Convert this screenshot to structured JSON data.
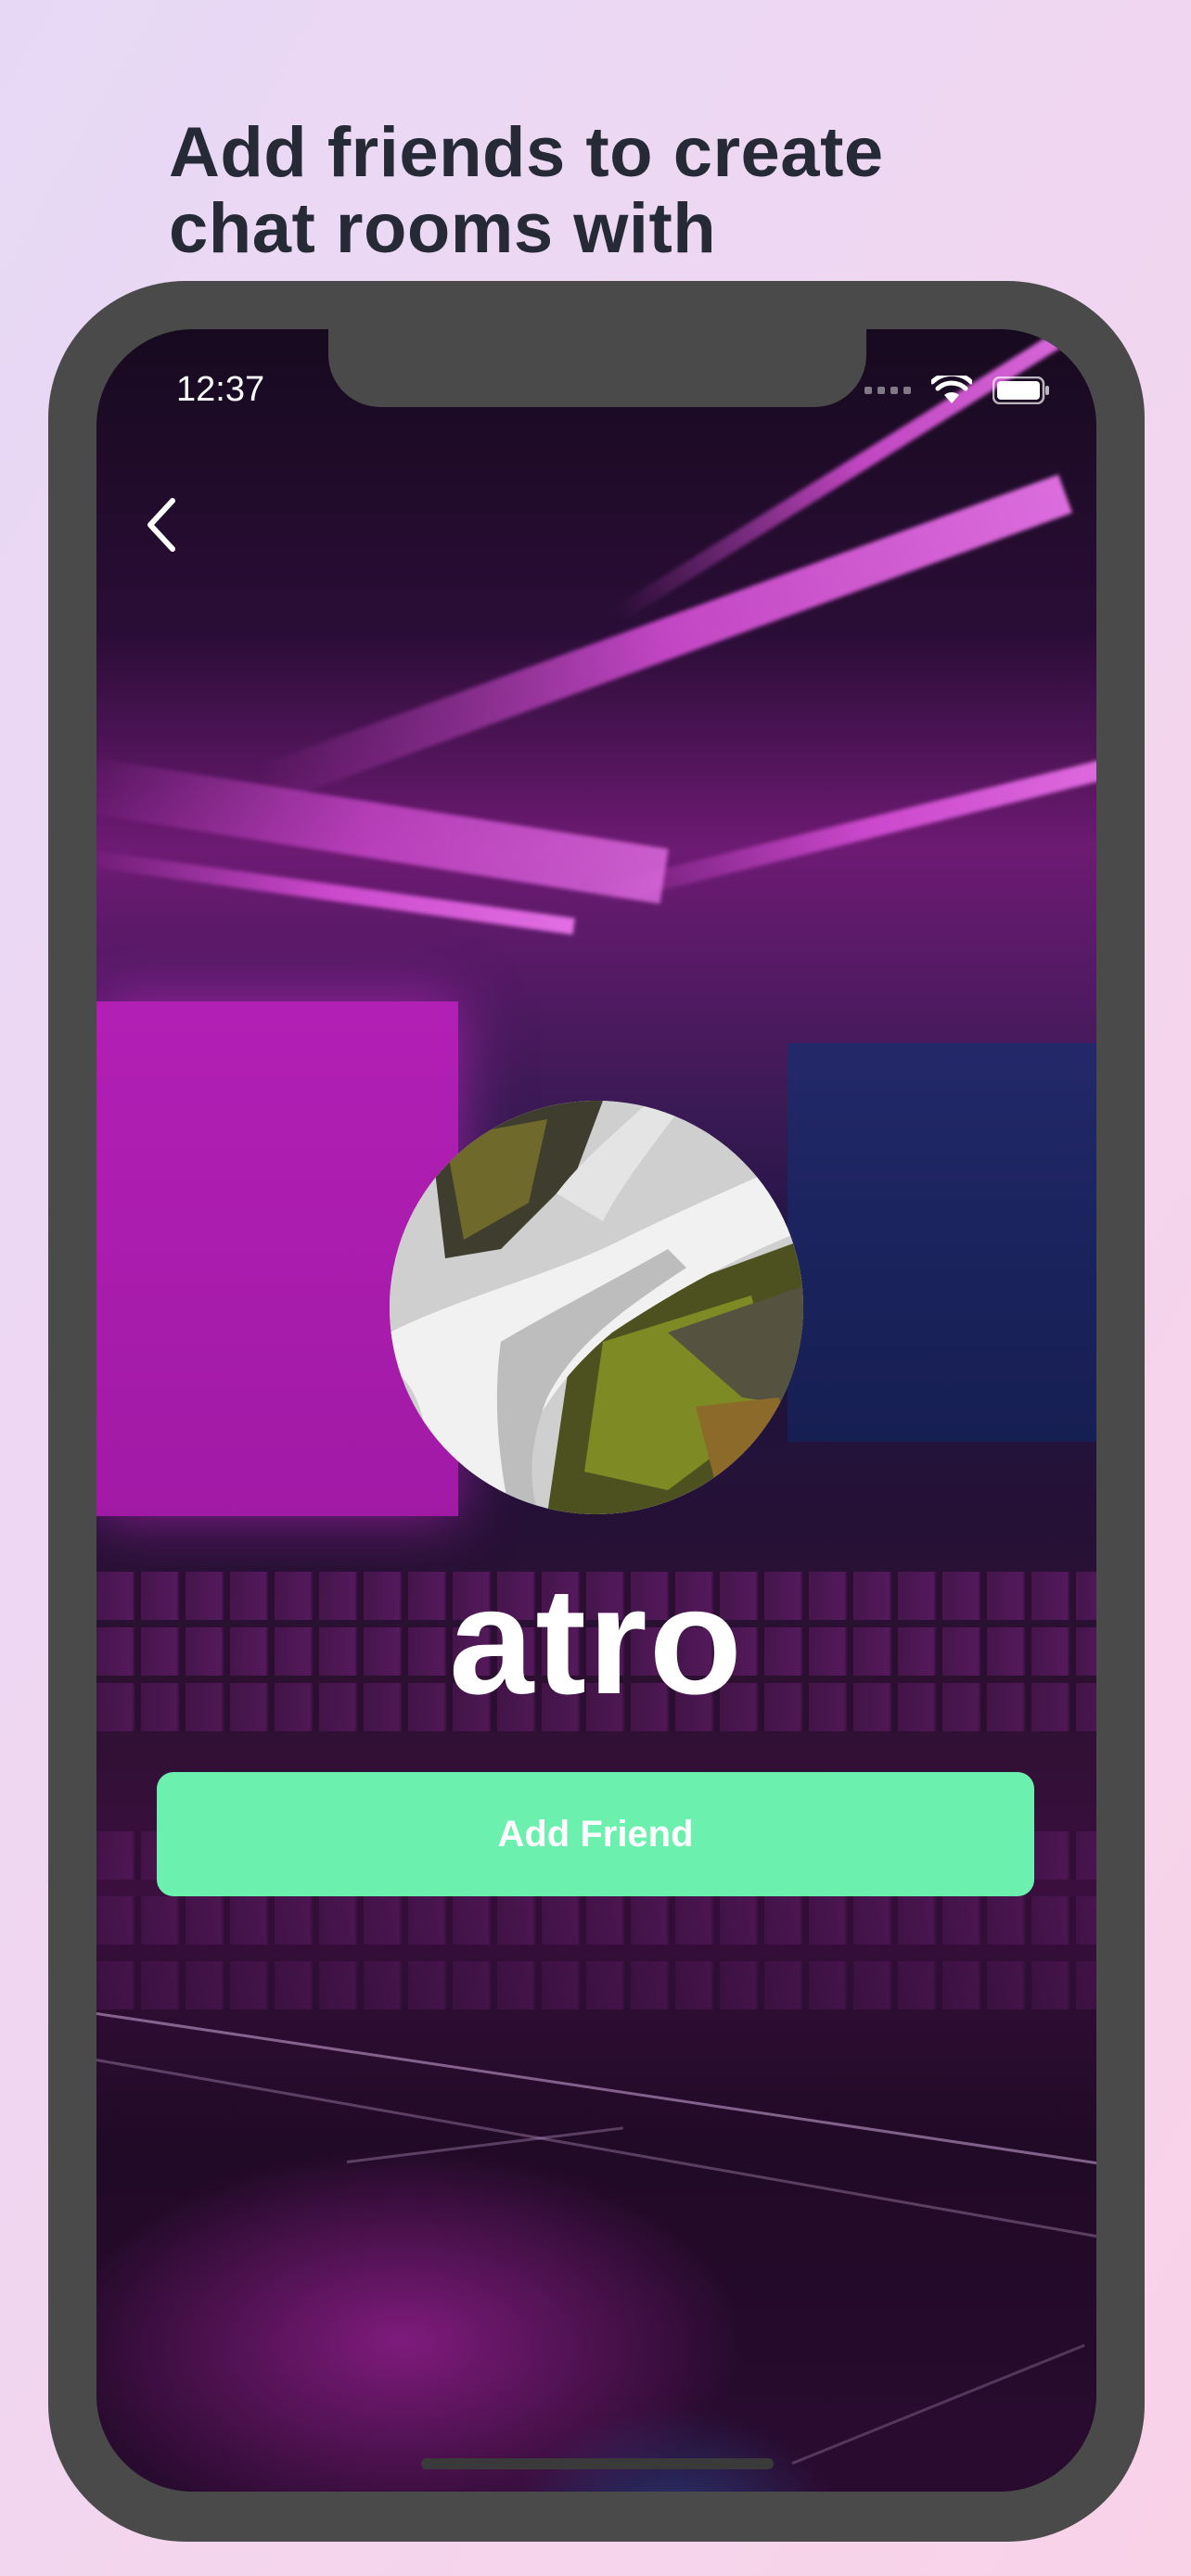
{
  "promo": {
    "headline_line1": "Add friends to create",
    "headline_line2": "chat rooms with"
  },
  "status_bar": {
    "time": "12:37"
  },
  "navigation": {
    "back_icon": "chevron-left-icon"
  },
  "profile": {
    "avatar_image": "waterfall-photo",
    "username": "atro"
  },
  "actions": {
    "add_friend_label": "Add Friend"
  },
  "colors": {
    "accent_button": "#6bf0ad",
    "headline_text": "#262a36",
    "frame": "#4a4a4a"
  }
}
